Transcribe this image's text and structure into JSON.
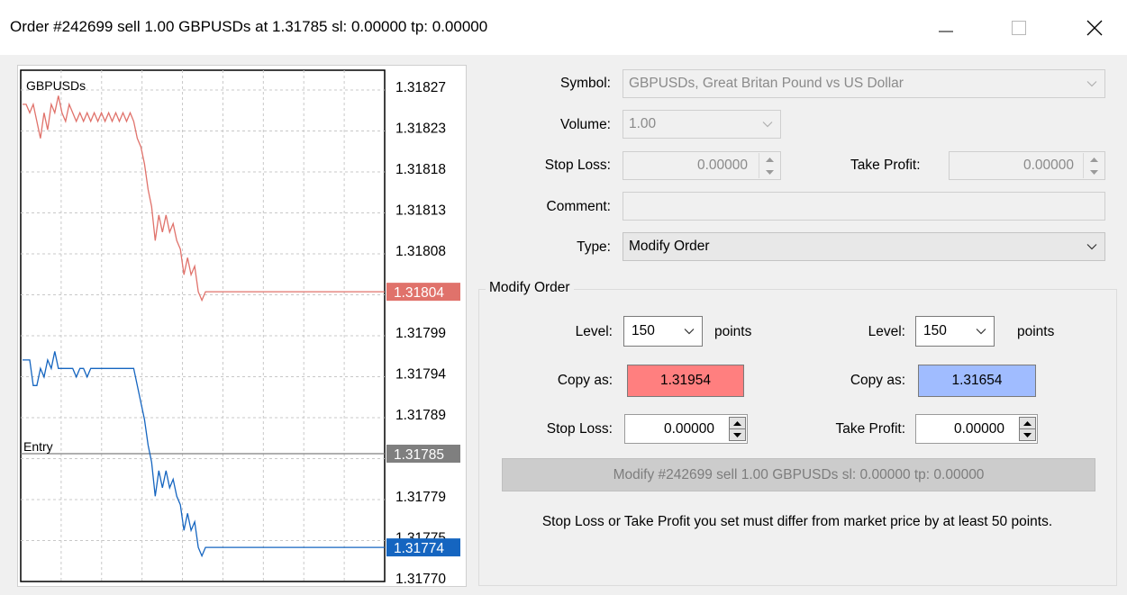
{
  "window": {
    "title": "Order #242699 sell 1.00 GBPUSDs at 1.31785 sl: 0.00000 tp: 0.00000",
    "minimize_icon": "minimize-icon",
    "maximize_icon": "maximize-icon",
    "close_icon": "close-icon"
  },
  "chart_data": {
    "type": "line",
    "title": "GBPUSDs",
    "ylim": [
      1.3177,
      1.3183
    ],
    "yticks": [
      "1.31827",
      "1.31823",
      "1.31818",
      "1.31813",
      "1.31808",
      "1.31804",
      "1.31799",
      "1.31794",
      "1.31789",
      "1.31785",
      "1.31779",
      "1.31775",
      "1.31770"
    ],
    "grid": true,
    "series": [
      {
        "color": "#e0726b",
        "current": "1.31804",
        "values": [
          1.31826,
          1.31826,
          1.31825,
          1.31826,
          1.31824,
          1.31822,
          1.31825,
          1.31823,
          1.31826,
          1.31825,
          1.31827,
          1.31825,
          1.31824,
          1.31826,
          1.31825,
          1.31824,
          1.31825,
          1.31824,
          1.31825,
          1.31824,
          1.31825,
          1.31824,
          1.31825,
          1.31824,
          1.31825,
          1.31824,
          1.31825,
          1.31824,
          1.31825,
          1.31824,
          1.31825,
          1.31824,
          1.31822,
          1.31821,
          1.31819,
          1.31816,
          1.31814,
          1.3181,
          1.31813,
          1.31811,
          1.31813,
          1.31811,
          1.31812,
          1.3181,
          1.31809,
          1.31806,
          1.31808,
          1.31806,
          1.31807,
          1.31804,
          1.31803,
          1.31804,
          1.31804,
          1.31804,
          1.31804,
          1.31804,
          1.31804,
          1.31804,
          1.31804,
          1.31804,
          1.31804,
          1.31804,
          1.31804,
          1.31804,
          1.31804,
          1.31804,
          1.31804,
          1.31804,
          1.31804,
          1.31804,
          1.31804,
          1.31804,
          1.31804,
          1.31804,
          1.31804,
          1.31804,
          1.31804,
          1.31804,
          1.31804,
          1.31804
        ]
      },
      {
        "color": "#1565c0",
        "current": "1.31774",
        "values": [
          1.31796,
          1.31796,
          1.31796,
          1.31793,
          1.31793,
          1.31795,
          1.31794,
          1.31796,
          1.31795,
          1.31797,
          1.31795,
          1.31795,
          1.31795,
          1.31795,
          1.31795,
          1.31794,
          1.31795,
          1.31795,
          1.31794,
          1.31795,
          1.31795,
          1.31795,
          1.31795,
          1.31795,
          1.31795,
          1.31795,
          1.31795,
          1.31795,
          1.31795,
          1.31795,
          1.31795,
          1.31795,
          1.31793,
          1.31791,
          1.31789,
          1.31786,
          1.31784,
          1.3178,
          1.31783,
          1.31781,
          1.31783,
          1.31781,
          1.31782,
          1.3178,
          1.31779,
          1.31776,
          1.31778,
          1.31776,
          1.31777,
          1.31774,
          1.31773,
          1.31774,
          1.31774,
          1.31774,
          1.31774,
          1.31774,
          1.31774,
          1.31774,
          1.31774,
          1.31774,
          1.31774,
          1.31774,
          1.31774,
          1.31774,
          1.31774,
          1.31774,
          1.31774,
          1.31774,
          1.31774,
          1.31774,
          1.31774,
          1.31774,
          1.31774,
          1.31774,
          1.31774,
          1.31774,
          1.31774,
          1.31774,
          1.31774,
          1.31774
        ]
      }
    ],
    "entry": {
      "label": "Entry",
      "value": 1.31785,
      "price": "1.31785",
      "color": "#7f7f7f"
    }
  },
  "form": {
    "symbol_label": "Symbol:",
    "symbol_value": "GBPUSDs, Great Britan Pound vs US Dollar",
    "volume_label": "Volume:",
    "volume_value": "1.00",
    "stop_loss_label": "Stop Loss:",
    "stop_loss_value": "0.00000",
    "take_profit_label": "Take Profit:",
    "take_profit_value": "0.00000",
    "comment_label": "Comment:",
    "comment_value": "",
    "type_label": "Type:",
    "type_value": "Modify Order"
  },
  "modify": {
    "group_title": "Modify Order",
    "left": {
      "level_label": "Level:",
      "level_value": "150",
      "points_label": "points",
      "copy_label": "Copy as:",
      "copy_value": "1.31954",
      "copy_color": "#ff7f7f",
      "sl_label": "Stop Loss:",
      "sl_value": "0.00000"
    },
    "right": {
      "level_label": "Level:",
      "level_value": "150",
      "points_label": "points",
      "copy_label": "Copy as:",
      "copy_value": "1.31654",
      "copy_color": "#a0bcff",
      "tp_label": "Take Profit:",
      "tp_value": "0.00000"
    },
    "button_label": "Modify #242699 sell 1.00 GBPUSDs sl: 0.00000 tp: 0.00000",
    "notice": "Stop Loss or Take Profit you set must differ from market price by at least 50 points."
  }
}
